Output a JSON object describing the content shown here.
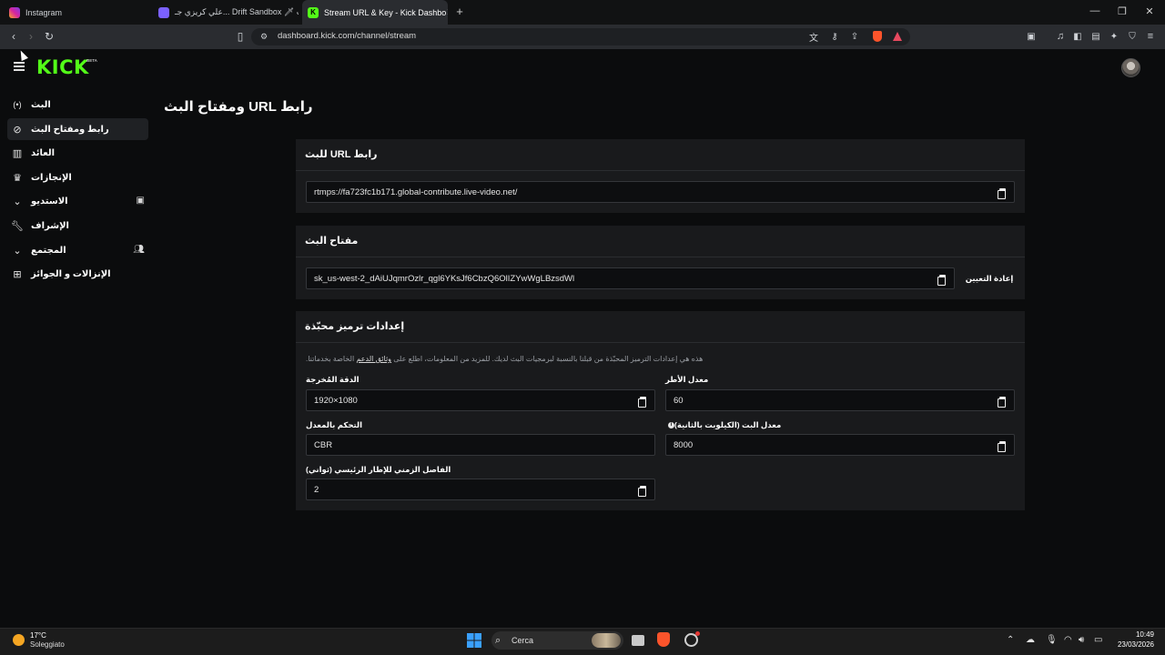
{
  "browser": {
    "tabs": [
      {
        "title": "Instagram",
        "favicon_color": "#d6249f"
      },
      {
        "title": "علي كريزي جـ... Drift Sandbox 🗡 الغب",
        "favicon_color": "#7b61ff"
      },
      {
        "title": "Stream URL & Key - Kick Dashbo",
        "favicon_color": "#53fc18",
        "active": true
      }
    ],
    "new_tab": "+",
    "url": "dashboard.kick.com/channel/stream"
  },
  "header": {
    "logo": "KICK",
    "beta": "BETA"
  },
  "sidebar": {
    "items": [
      {
        "label": "البث",
        "icon": "broadcast-icon"
      },
      {
        "label": "رابط ومفتاح البث",
        "icon": "link-icon",
        "active": true
      },
      {
        "label": "العائد",
        "icon": "chart-icon"
      },
      {
        "label": "الإنجازات",
        "icon": "trophy-icon"
      },
      {
        "label": "الاستديو",
        "icon": "chevron-down-icon",
        "extra": "studio-icon"
      },
      {
        "label": "الإشراف",
        "icon": "wrench-icon"
      },
      {
        "label": "المجتمع",
        "icon": "chevron-down-icon",
        "extra": "users-icon"
      },
      {
        "label": "الإنزالات و الجوائز",
        "icon": "gift-icon"
      }
    ]
  },
  "main": {
    "title": "رابط URL ومفتاح البث",
    "stream_url": {
      "title": "رابط URL للبث",
      "value": "rtmps://fa723fc1b171.global-contribute.live-video.net/"
    },
    "stream_key": {
      "title": "مفتاح البث",
      "value": "sk_us-west-2_dAiUJqmrOzlr_qgl6YKsJf6CbzQ6OlIZYwWgLBzsdWl",
      "reset_label": "إعادة التعيين"
    },
    "encoding": {
      "title": "إعدادات ترميز محبّذة",
      "description": "هذه هي إعدادات الترميز المحبّذة من قبلنا بالنسبة لبرمجيات البث لديك. للمزيد من المعلومات، اطلع على",
      "description_link": "وثائق الدعم",
      "description_tail": "الخاصة بخدماتنا.",
      "output_resolution_label": "الدقة المُخرجة",
      "output_resolution": "1920×1080",
      "framerate_label": "معدل الأطر",
      "framerate": "60",
      "rate_control_label": "التحكم بالمعدل",
      "rate_control": "CBR",
      "bitrate_label": "معدل البت (الكيلوبت بالثانية)",
      "bitrate": "8000",
      "keyframe_label": "الفاصل الزمني للإطار الرئيسي (ثواني)",
      "keyframe": "2"
    }
  },
  "taskbar": {
    "temperature": "17°C",
    "weather": "Soleggiato",
    "search": "Cerca",
    "time": "10:49",
    "date": "23/03/2026"
  }
}
